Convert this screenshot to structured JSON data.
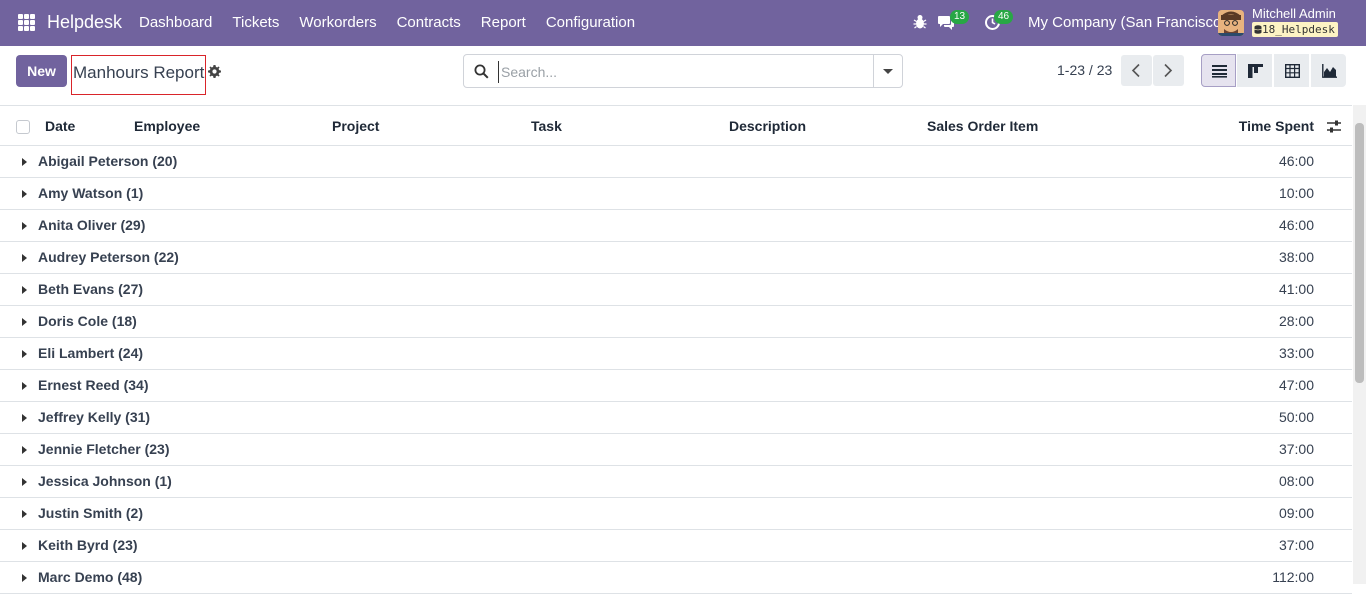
{
  "navbar": {
    "brand": "Helpdesk",
    "menu": [
      "Dashboard",
      "Tickets",
      "Workorders",
      "Contracts",
      "Report",
      "Configuration"
    ],
    "messages_count": "13",
    "activities_count": "46",
    "company": "My Company (San Francisco)",
    "user_name": "Mitchell Admin",
    "database": "18_Helpdesk"
  },
  "control_panel": {
    "new_label": "New",
    "title": "Manhours Report",
    "search_placeholder": "Search...",
    "pager": "1-23 / 23"
  },
  "list": {
    "columns": [
      "Date",
      "Employee",
      "Project",
      "Task",
      "Description",
      "Sales Order Item",
      "Time Spent"
    ],
    "groups": [
      {
        "name": "Abigail Peterson (20)",
        "time": "46:00"
      },
      {
        "name": "Amy Watson (1)",
        "time": "10:00"
      },
      {
        "name": "Anita Oliver (29)",
        "time": "46:00"
      },
      {
        "name": "Audrey Peterson (22)",
        "time": "38:00"
      },
      {
        "name": "Beth Evans (27)",
        "time": "41:00"
      },
      {
        "name": "Doris Cole (18)",
        "time": "28:00"
      },
      {
        "name": "Eli Lambert (24)",
        "time": "33:00"
      },
      {
        "name": "Ernest Reed (34)",
        "time": "47:00"
      },
      {
        "name": "Jeffrey Kelly (31)",
        "time": "50:00"
      },
      {
        "name": "Jennie Fletcher (23)",
        "time": "37:00"
      },
      {
        "name": "Jessica Johnson (1)",
        "time": "08:00"
      },
      {
        "name": "Justin Smith (2)",
        "time": "09:00"
      },
      {
        "name": "Keith Byrd (23)",
        "time": "37:00"
      },
      {
        "name": "Marc Demo (48)",
        "time": "112:00"
      }
    ]
  }
}
